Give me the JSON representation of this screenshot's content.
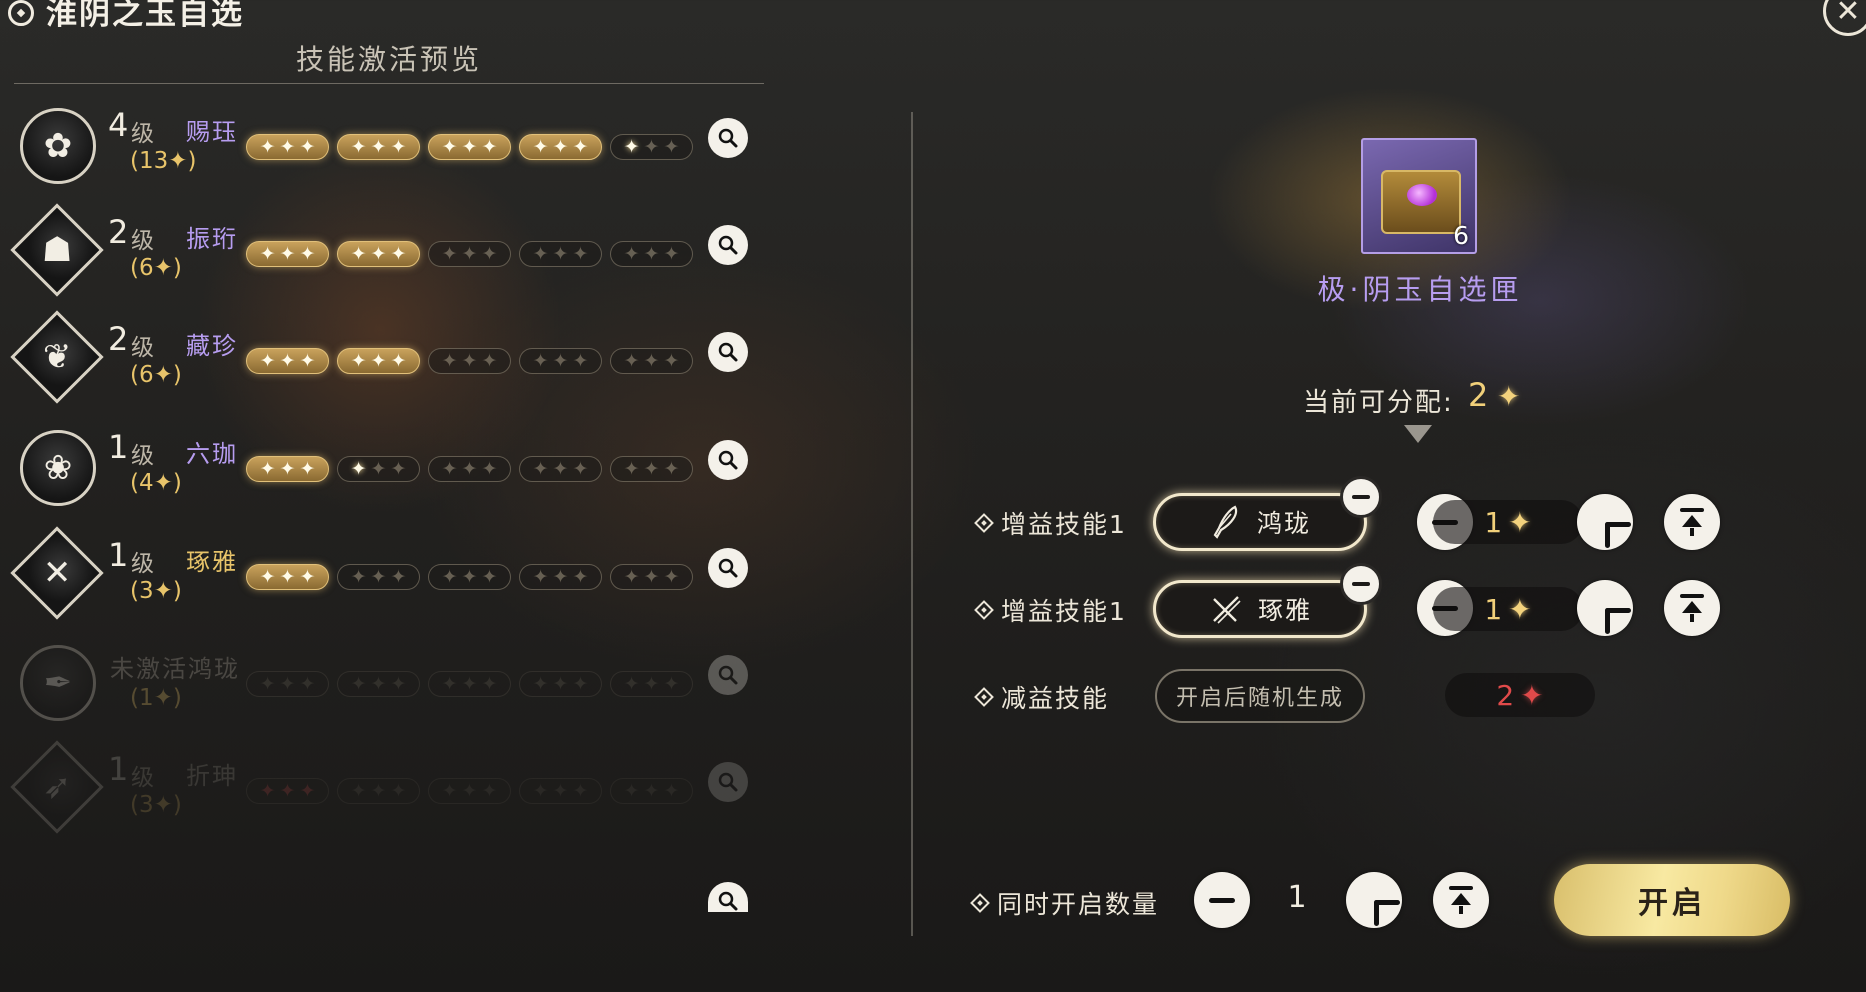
{
  "header": {
    "title": "淮阴之玉自选",
    "subtitle": "技能激活预览",
    "close_label": "✕"
  },
  "skills": [
    {
      "level": "4",
      "level_suffix": "级",
      "name": "赐珏",
      "count": "(13✦)",
      "filled_stars": 13
    },
    {
      "level": "2",
      "level_suffix": "级",
      "name": "振珩",
      "count": "(6✦)",
      "filled_stars": 6
    },
    {
      "level": "2",
      "level_suffix": "级",
      "name": "藏珍",
      "count": "(6✦)",
      "filled_stars": 6
    },
    {
      "level": "1",
      "level_suffix": "级",
      "name": "六珈",
      "count": "(4✦)",
      "filled_stars": 4
    },
    {
      "level": "1",
      "level_suffix": "级",
      "name": "琢雅",
      "count": "(3✦)",
      "filled_stars": 3
    },
    {
      "level": "",
      "level_suffix": "",
      "name": "未激活鸿珑",
      "count": "(1✦)",
      "filled_stars": 0
    },
    {
      "level": "1",
      "level_suffix": "级",
      "name": "折珅",
      "count": "(3✦)",
      "filled_stars": 0
    }
  ],
  "item": {
    "name": "极·阴玉自选匣",
    "count": "6"
  },
  "allocation": {
    "label": "当前可分配:",
    "value": "2",
    "star": "✦"
  },
  "buff_rows": [
    {
      "label": "增益技能1",
      "skill": "鸿珑",
      "skill_icon": "feather-sword-icon",
      "value": "1",
      "star": "✦"
    },
    {
      "label": "增益技能1",
      "skill": "琢雅",
      "skill_icon": "crossed-swords-icon",
      "value": "1",
      "star": "✦"
    }
  ],
  "debuff_row": {
    "label": "减益技能",
    "placeholder": "开启后随机生成",
    "value": "2",
    "star": "✦"
  },
  "quantity": {
    "label": "同时开启数量",
    "value": "1"
  },
  "open_button": "开启",
  "colors": {
    "purple": "#b79df0",
    "gold": "#f1d07a",
    "red": "#e04a4a"
  }
}
